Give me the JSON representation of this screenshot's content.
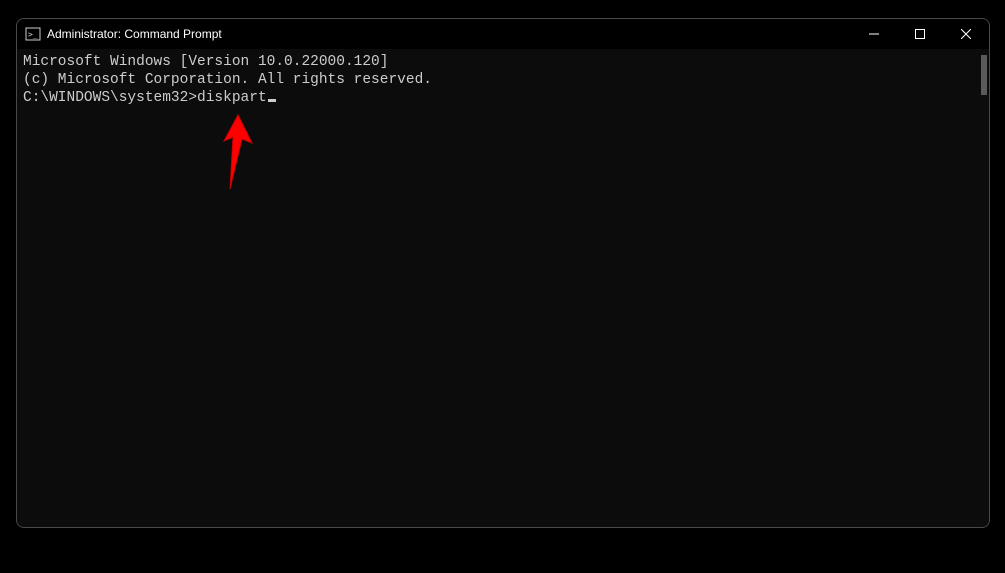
{
  "window": {
    "title": "Administrator: Command Prompt"
  },
  "terminal": {
    "line1": "Microsoft Windows [Version 10.0.22000.120]",
    "line2": "(c) Microsoft Corporation. All rights reserved.",
    "blank": "",
    "prompt": "C:\\WINDOWS\\system32>",
    "command": "diskpart"
  }
}
